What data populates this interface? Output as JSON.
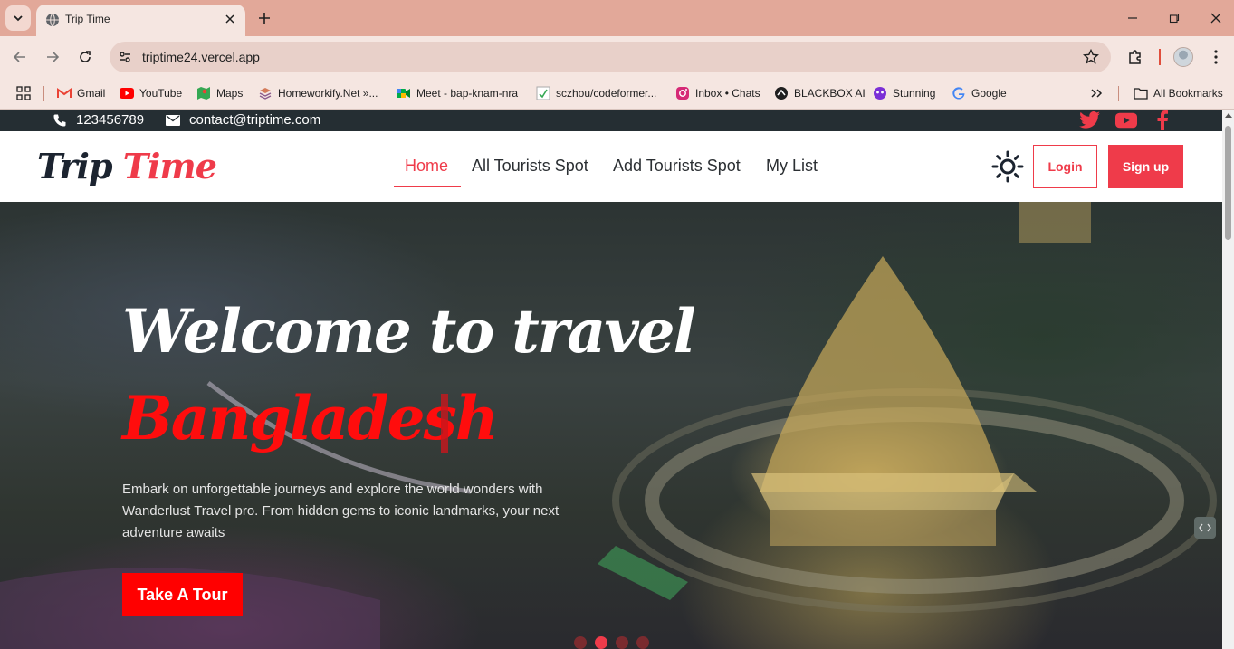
{
  "browser": {
    "tab_title": "Trip Time",
    "url": "triptime24.vercel.app",
    "bookmarks": [
      {
        "label": "Gmail",
        "icon": "gmail-icon"
      },
      {
        "label": "YouTube",
        "icon": "youtube-icon"
      },
      {
        "label": "Maps",
        "icon": "maps-icon"
      },
      {
        "label": "Homeworkify.Net »...",
        "icon": "homeworkify-icon"
      },
      {
        "label": "Meet - bap-knam-nra",
        "icon": "meet-icon"
      },
      {
        "label": "sczhou/codeformer...",
        "icon": "codeformer-icon"
      },
      {
        "label": "Inbox • Chats",
        "icon": "instagram-icon"
      },
      {
        "label": "BLACKBOX AI",
        "icon": "blackbox-icon"
      },
      {
        "label": "Stunning",
        "icon": "stunning-icon"
      },
      {
        "label": "Google",
        "icon": "google-icon"
      }
    ],
    "all_bookmarks": "All Bookmarks"
  },
  "topbar": {
    "phone": "123456789",
    "email": "contact@triptime.com"
  },
  "navbar": {
    "logo_part1": "Trip",
    "logo_part2": "Time",
    "links": [
      "Home",
      "All Tourists Spot",
      "Add Tourists Spot",
      "My List"
    ],
    "active_link": "Home",
    "login": "Login",
    "signup": "Sign up"
  },
  "hero": {
    "title_line1": "Welcome to travel",
    "title_line2": "Bangladesh",
    "description": "Embark on unforgettable journeys and explore the world wonders with Wanderlust Travel pro. From hidden gems to iconic landmarks, your next adventure awaits",
    "button": "Take A Tour",
    "slide_count": 4,
    "active_slide": 2
  },
  "colors": {
    "accent": "#ef3b4a",
    "hero_red": "#ff0d0d",
    "topbar_bg": "#252e33",
    "chrome_tab_bg": "#e2a899"
  }
}
